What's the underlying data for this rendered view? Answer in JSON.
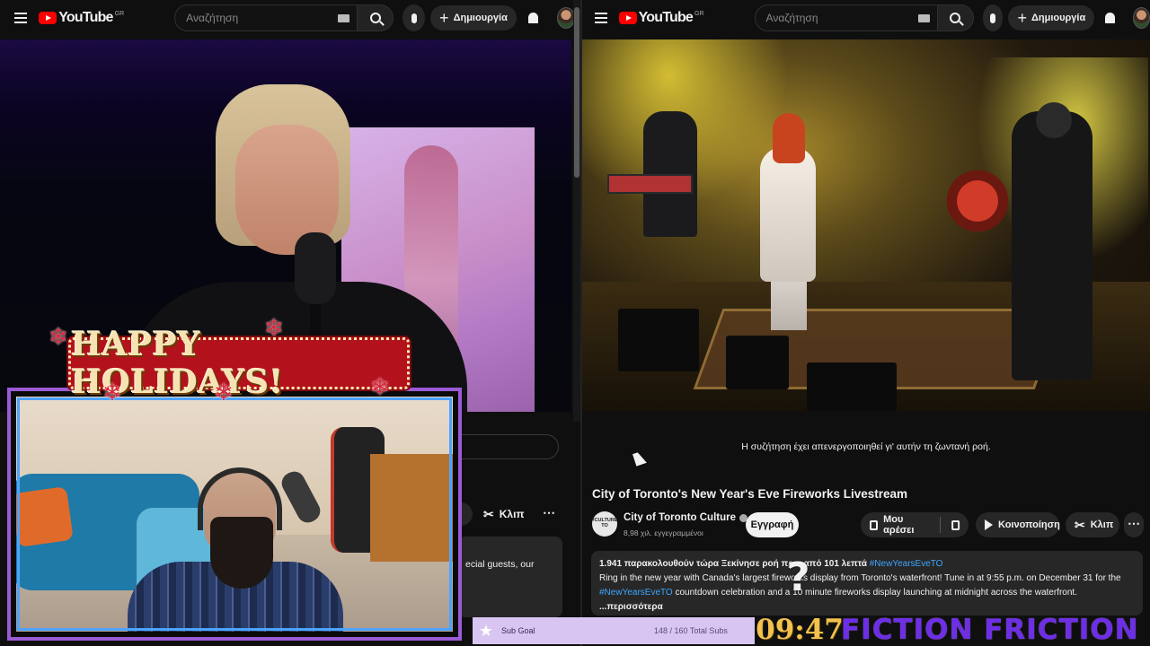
{
  "left_header": {
    "logo": "YouTube",
    "country": "GR",
    "search_placeholder": "Αναζήτηση",
    "create_label": "Δημιουργία"
  },
  "right_header": {
    "logo": "YouTube",
    "country": "GR",
    "search_placeholder": "Αναζήτηση",
    "create_label": "Δημιουργία"
  },
  "left_page": {
    "clip_label": "Κλιπ",
    "description_snippet": "ecial guests, our",
    "partial_button": "n"
  },
  "right_page": {
    "chat_disabled": "Η συζήτηση έχει απενεργοποιηθεί γι' αυτήν τη ζωντανή ροή.",
    "video_title": "City of Toronto's New Year's Eve Fireworks Livestream",
    "channel_name": "City of Toronto Culture",
    "channel_avatar_text": "#CULTURE TO",
    "subscribers": "8,98 χιλ. εγγεγραμμένοι",
    "subscribe_label": "Εγγραφή",
    "like_label": "Μου αρέσει",
    "share_label": "Κοινοποίηση",
    "clip_label": "Κλιπ",
    "description": {
      "stats": "1.941 παρακολουθούν τώρα  Ξεκίνησε ροή πριν από 101 λεπτά",
      "stats_tag": "#NewYearsEveTO",
      "line2": "Ring in the new year with Canada's largest fireworks display from Toronto's waterfront! Tune in at 9:55 p.m. on December 31 for the",
      "line3_tag": "#NewYearsEveTO",
      "line3": " countdown celebration and a 10 minute fireworks display launching at midnight across the waterfront.",
      "more": "...περισσότερα"
    }
  },
  "overlays": {
    "holiday_banner": "HAPPY HOLIDAYS!",
    "sub_goal_label": "Sub Goal",
    "sub_goal_count": "148 / 160 Total Subs",
    "sub_goal_progress": 0.925,
    "clock": "09:47",
    "brand": "FICTION FRICTION",
    "question_mark": "?"
  },
  "colors": {
    "yt_red": "#ff0000",
    "subscribe_bg": "#f1f1f1",
    "hashtag": "#3ea6ff",
    "sub_goal_bg": "#d8c5f2",
    "clock": "#f2c14e",
    "brand": "#6d2ee6",
    "webcam_border": "#9b5bd6"
  }
}
